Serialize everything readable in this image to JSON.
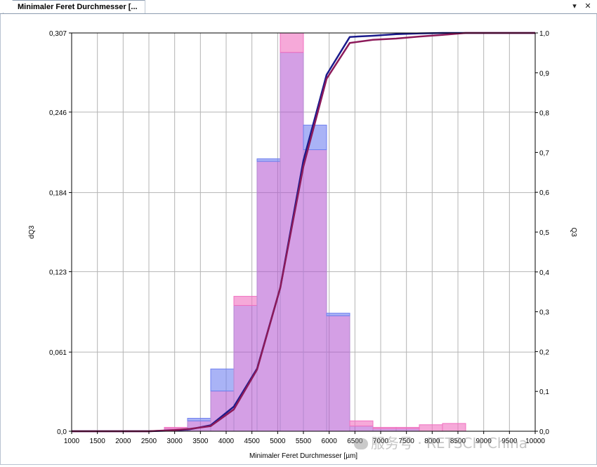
{
  "window": {
    "tab_title": "Minimaler Feret Durchmesser [...",
    "dropdown_icon": "chevron-down-icon",
    "close_icon": "close-icon"
  },
  "watermark": {
    "text": "服务号 · RETSCH China"
  },
  "colors": {
    "series1_line": "#1a1a8c",
    "series2_line": "#8c1a5a",
    "series1_bar": "#7080f0",
    "series2_bar": "#f070c0",
    "overlap_bar": "#b050d0",
    "grid": "#b4b4b4"
  },
  "chart_data": {
    "type": "bar",
    "xlabel": "Minimaler Feret Durchmesser [µm]",
    "ylabel_left": "dQ3",
    "ylabel_right": "Q3",
    "xlim": [
      1000,
      10000
    ],
    "ylim_left": [
      0,
      0.307
    ],
    "ylim_right": [
      0,
      1.0
    ],
    "x_ticks": [
      1000,
      1500,
      2000,
      2500,
      3000,
      3500,
      4000,
      4500,
      5000,
      5500,
      6000,
      6500,
      7000,
      7500,
      8000,
      8500,
      9000,
      9500,
      10000
    ],
    "y_left_ticks": [
      "0,0",
      "0,061",
      "0,123",
      "0,184",
      "0,246",
      "0,307"
    ],
    "y_left_tick_values": [
      0,
      0.061,
      0.123,
      0.184,
      0.246,
      0.307
    ],
    "y_right_ticks": [
      "0,0",
      "0,1",
      "0,2",
      "0,3",
      "0,4",
      "0,5",
      "0,6",
      "0,7",
      "0,8",
      "0,9",
      "1,0"
    ],
    "grid": true,
    "bins": [
      [
        2800,
        3250
      ],
      [
        3250,
        3700
      ],
      [
        3700,
        4150
      ],
      [
        4150,
        4600
      ],
      [
        4600,
        5050
      ],
      [
        5050,
        5500
      ],
      [
        5500,
        5950
      ],
      [
        5950,
        6400
      ],
      [
        6400,
        6850
      ],
      [
        6850,
        7300
      ],
      [
        7300,
        7750
      ],
      [
        7750,
        8200
      ],
      [
        8200,
        8650
      ]
    ],
    "series": [
      {
        "values": [
          0.002,
          0.01,
          0.048,
          0.097,
          0.21,
          0.292,
          0.236,
          0.091,
          0.004,
          0.002,
          0.002,
          0.0,
          0.0
        ],
        "cumulative_x": [
          1000,
          1500,
          2000,
          2500,
          3000,
          3300,
          3700,
          4150,
          4600,
          5050,
          5500,
          5950,
          6400,
          6850,
          7300,
          7750,
          8200,
          8650,
          9000,
          9500,
          10000
        ],
        "cumulative_y": [
          0.0,
          0.0,
          0.0,
          0.0,
          0.002,
          0.005,
          0.015,
          0.062,
          0.157,
          0.36,
          0.68,
          0.895,
          0.99,
          0.993,
          0.997,
          0.999,
          1.0,
          1.0,
          1.0,
          1.0,
          1.0
        ]
      },
      {
        "values": [
          0.003,
          0.008,
          0.031,
          0.104,
          0.208,
          0.307,
          0.217,
          0.089,
          0.008,
          0.003,
          0.003,
          0.005,
          0.006
        ],
        "cumulative_x": [
          1000,
          1500,
          2000,
          2500,
          3000,
          3300,
          3700,
          4150,
          4600,
          5050,
          5500,
          5950,
          6400,
          6850,
          7300,
          7750,
          8200,
          8650,
          9000,
          9500,
          10000
        ],
        "cumulative_y": [
          0.0,
          0.0,
          0.0,
          0.0,
          0.003,
          0.006,
          0.013,
          0.055,
          0.155,
          0.36,
          0.665,
          0.885,
          0.975,
          0.983,
          0.986,
          0.991,
          0.995,
          1.0,
          1.0,
          1.0,
          1.0
        ]
      }
    ]
  }
}
